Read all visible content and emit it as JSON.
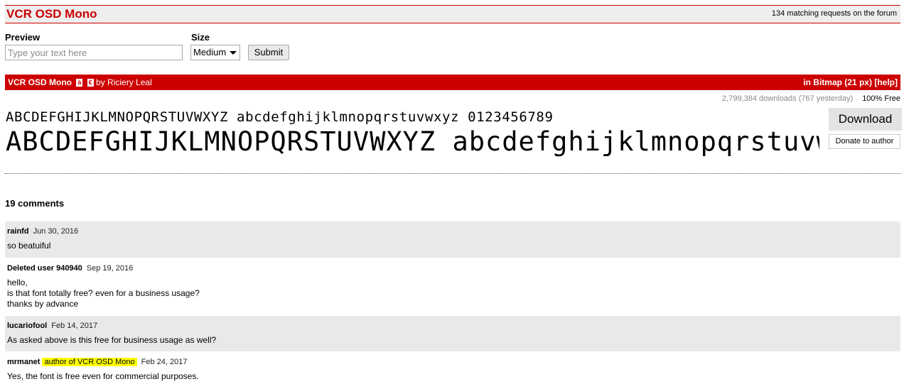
{
  "header": {
    "title": "VCR OSD Mono",
    "forum_link": "134 matching requests on the forum"
  },
  "form": {
    "preview_label": "Preview",
    "preview_placeholder": "Type your text here",
    "size_label": "Size",
    "size_value": "Medium",
    "submit_label": "Submit"
  },
  "font_bar": {
    "name": "VCR OSD Mono",
    "badge_1": "à",
    "badge_2": "€",
    "by_author": "by Riciery Leal",
    "category": "in Bitmap (21 px)",
    "help": "[help]"
  },
  "stats": {
    "downloads": "2,799,384 downloads (767 yesterday)",
    "license": "100% Free"
  },
  "samples": {
    "small": "ABCDEFGHIJKLMNOPQRSTUVWXYZ abcdefghijklmnopqrstuvwxyz 0123456789",
    "large": "ABCDEFGHIJKLMNOPQRSTUVWXYZ abcdefghijklmnopqrstuvwxyz"
  },
  "actions": {
    "download": "Download",
    "donate": "Donate to author"
  },
  "comments": {
    "count": "19 comments",
    "items": [
      {
        "user": "rainfd",
        "date": "Jun 30, 2016",
        "body": "so beatuiful"
      },
      {
        "user": "Deleted user 940940",
        "date": "Sep 19, 2016",
        "line1": "hello,",
        "line2": "is that font totally free? even for a business usage?",
        "line3": "thanks by advance"
      },
      {
        "user": "lucariofool",
        "date": "Feb 14, 2017",
        "body": "As asked above is this free for business usage as well?"
      },
      {
        "user": "mrmanet",
        "tag": "author of VCR OSD Mono",
        "date": "Feb 24, 2017",
        "body": "Yes, the font is free even for commercial purposes."
      }
    ]
  }
}
